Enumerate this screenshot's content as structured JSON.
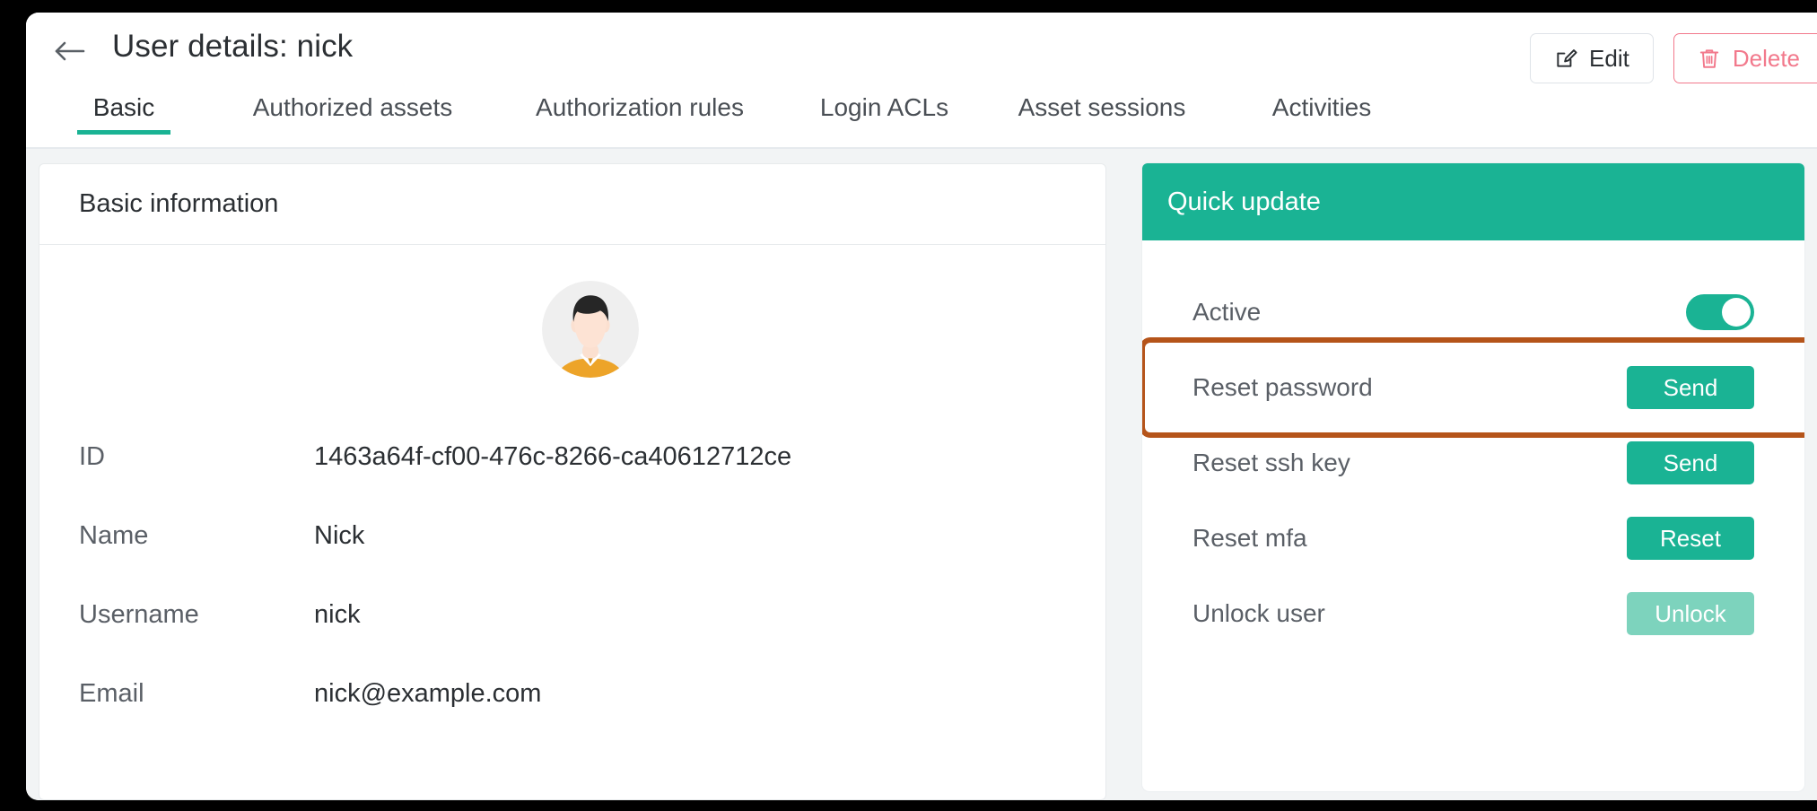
{
  "header": {
    "title": "User details: nick",
    "back_icon": "arrow-left-icon",
    "edit_label": "Edit",
    "edit_icon": "edit-pencil-icon",
    "delete_label": "Delete",
    "delete_icon": "trash-icon"
  },
  "tabs": [
    {
      "label": "Basic",
      "active": true
    },
    {
      "label": "Authorized assets",
      "active": false
    },
    {
      "label": "Authorization rules",
      "active": false
    },
    {
      "label": "Login ACLs",
      "active": false
    },
    {
      "label": "Asset sessions",
      "active": false
    },
    {
      "label": "Activities",
      "active": false
    }
  ],
  "basic_card": {
    "title": "Basic information",
    "avatar_icon": "user-avatar-illustration",
    "fields": [
      {
        "label": "ID",
        "value": "1463a64f-cf00-476c-8266-ca40612712ce"
      },
      {
        "label": "Name",
        "value": "Nick"
      },
      {
        "label": "Username",
        "value": "nick"
      },
      {
        "label": "Email",
        "value": "nick@example.com"
      }
    ]
  },
  "quick_update": {
    "title": "Quick update",
    "active_label": "Active",
    "active_state": "on",
    "rows": [
      {
        "label": "Reset password",
        "button": "Send",
        "disabled": false,
        "highlighted": true
      },
      {
        "label": "Reset ssh key",
        "button": "Send",
        "disabled": false,
        "highlighted": false
      },
      {
        "label": "Reset mfa",
        "button": "Reset",
        "disabled": false,
        "highlighted": false
      },
      {
        "label": "Unlock user",
        "button": "Unlock",
        "disabled": true,
        "highlighted": false
      }
    ]
  },
  "colors": {
    "accent_green": "#1ab394",
    "danger_red": "#f2798c",
    "highlight_brown": "#b5541a",
    "disabled_green": "#7dd3bd",
    "page_bg": "#f2f4f5"
  }
}
